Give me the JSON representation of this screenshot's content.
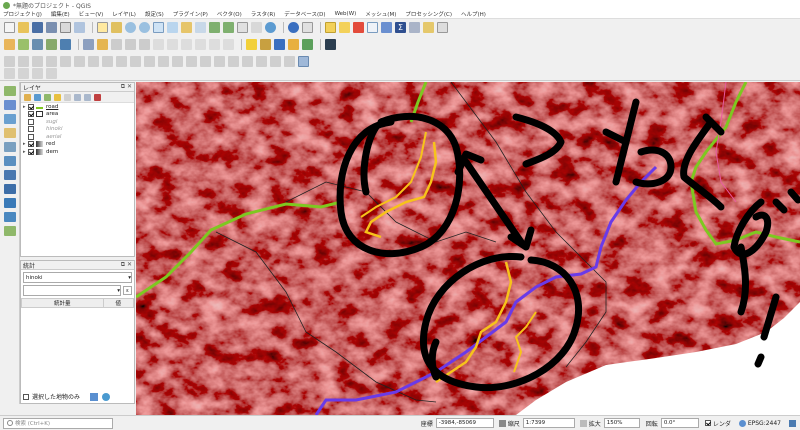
{
  "window": {
    "title": "*無題のプロジェクト - QGIS"
  },
  "menu": [
    "プロジェクト(J)",
    "編集(E)",
    "ビュー(V)",
    "レイヤ(L)",
    "設定(S)",
    "プラグイン(P)",
    "ベクタ(O)",
    "ラスタ(R)",
    "データベース(D)",
    "Web(W)",
    "メッシュ(M)",
    "プロセッシング(C)",
    "ヘルプ(H)"
  ],
  "layers_panel": {
    "title": "レイヤ",
    "items": [
      {
        "label": "road",
        "checked": true,
        "expanded": true,
        "symbol": "line-green",
        "underlined": true
      },
      {
        "label": "area",
        "checked": true,
        "expanded": false,
        "symbol": "polygon",
        "underlined": false
      },
      {
        "label": "sugi",
        "checked": false,
        "expanded": false,
        "symbol": "none",
        "underlined": false
      },
      {
        "label": "hinoki",
        "checked": false,
        "expanded": false,
        "symbol": "none",
        "underlined": false
      },
      {
        "label": "aerial",
        "checked": false,
        "expanded": false,
        "symbol": "none",
        "underlined": false
      },
      {
        "label": "red",
        "checked": true,
        "expanded": true,
        "symbol": "raster",
        "underlined": false
      },
      {
        "label": "dem",
        "checked": true,
        "expanded": true,
        "symbol": "raster",
        "underlined": false
      }
    ]
  },
  "stats_panel": {
    "title": "統計",
    "layer": "hinoki",
    "columns": [
      "統計量",
      "値"
    ],
    "selected_only_label": "選択した地物のみ"
  },
  "statusbar": {
    "search_placeholder": "検索 (Ctrl+K)",
    "coord_label": "座標",
    "coord_value": "-3984,-85069",
    "scale_label": "縮尺",
    "scale_value": "1:7399",
    "magnify_label": "拡大",
    "magnify_value": "150%",
    "rotation_label": "回転",
    "rotation_value": "0.0°",
    "render_label": "レンダ",
    "crs": "EPSG:2447"
  },
  "colors": {
    "road": "#7ec820",
    "river_purple": "#6a3ae8",
    "river_yellow": "#f7c31a",
    "relief": "#b23a3a"
  }
}
